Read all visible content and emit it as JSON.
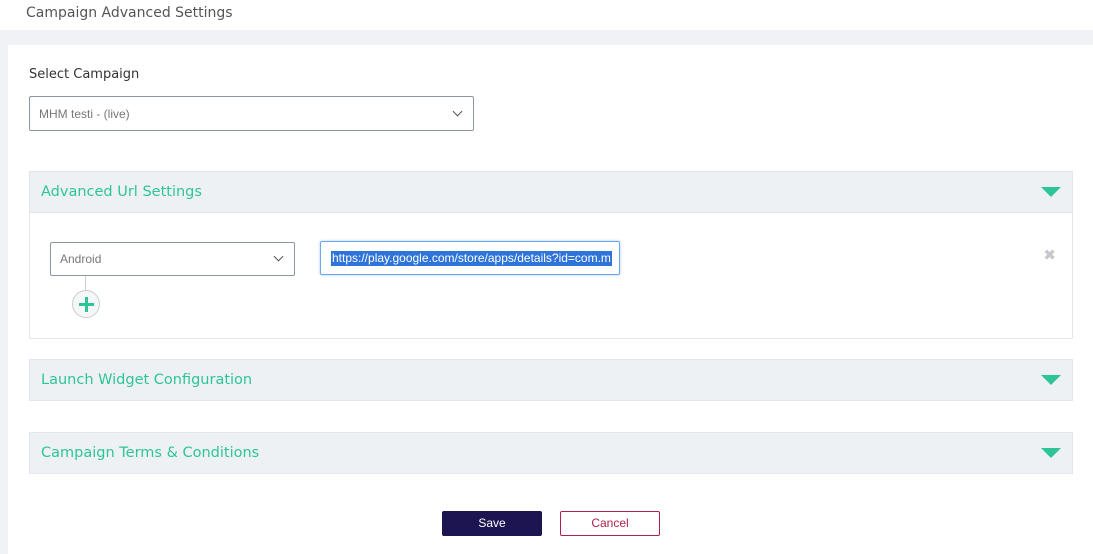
{
  "page": {
    "title": "Campaign Advanced Settings"
  },
  "campaign": {
    "label": "Select Campaign",
    "selected": "MHM testi - (live)"
  },
  "panels": {
    "url": {
      "title": "Advanced Url Settings"
    },
    "launch": {
      "title": "Launch Widget Configuration"
    },
    "terms": {
      "title": "Campaign Terms & Conditions"
    }
  },
  "url_settings": {
    "rows": [
      {
        "platform": "Android",
        "url": "https://play.google.com/store/apps/details?id=com.m"
      }
    ],
    "remove_glyph": "✖"
  },
  "icons": {
    "dropdown": "chevron-down-icon",
    "collapse": "caret-down-icon",
    "add": "plus-icon",
    "remove": "close-icon"
  },
  "actions": {
    "save_label": "Save",
    "cancel_label": "Cancel"
  },
  "colors": {
    "accent": "#2ec49a",
    "primary": "#1d1452",
    "danger": "#b0204d"
  }
}
